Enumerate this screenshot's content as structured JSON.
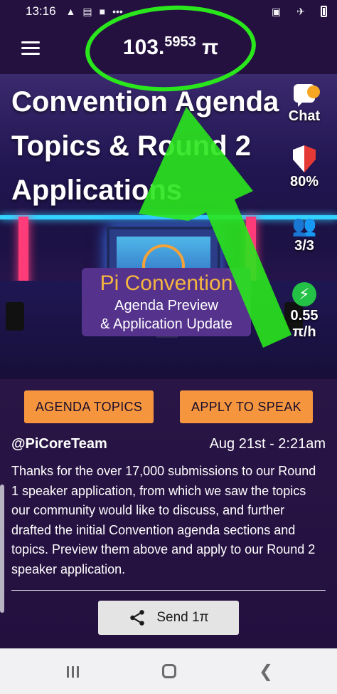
{
  "status_bar": {
    "time": "13:16",
    "icons": [
      "warning-icon",
      "news-icon",
      "bag-icon",
      "more-icon",
      "sim-icon",
      "airplane-icon",
      "battery-icon"
    ]
  },
  "app_bar": {
    "balance_int": "103.",
    "balance_frac": "5953",
    "balance_unit": "π"
  },
  "hero": {
    "title_line1": "Convention Agenda",
    "title_line2": "Topics & Round 2",
    "title_line3": "Applications",
    "card_title": "Pi Convention",
    "card_line1": "Agenda Preview",
    "card_line2": "& Application Update"
  },
  "widgets": {
    "chat_label": "Chat",
    "security_label": "80%",
    "team_label": "3/3",
    "rate_value": "0.55",
    "rate_unit": "π/h"
  },
  "content": {
    "agenda_button": "AGENDA TOPICS",
    "apply_button": "APPLY TO SPEAK",
    "author": "@PiCoreTeam",
    "date": "Aug 21st - 2:21am",
    "body": "Thanks for the over 17,000 submissions to our Round 1 speaker application, from which we saw the topics our community would like to discuss, and further drafted the initial Convention agenda sections and topics. Preview them above and apply to our Round 2 speaker application.",
    "send_label": "Send 1π"
  },
  "colors": {
    "accent_orange": "#f5963f",
    "annotation_green": "#2ae61d",
    "background": "#24103f"
  }
}
